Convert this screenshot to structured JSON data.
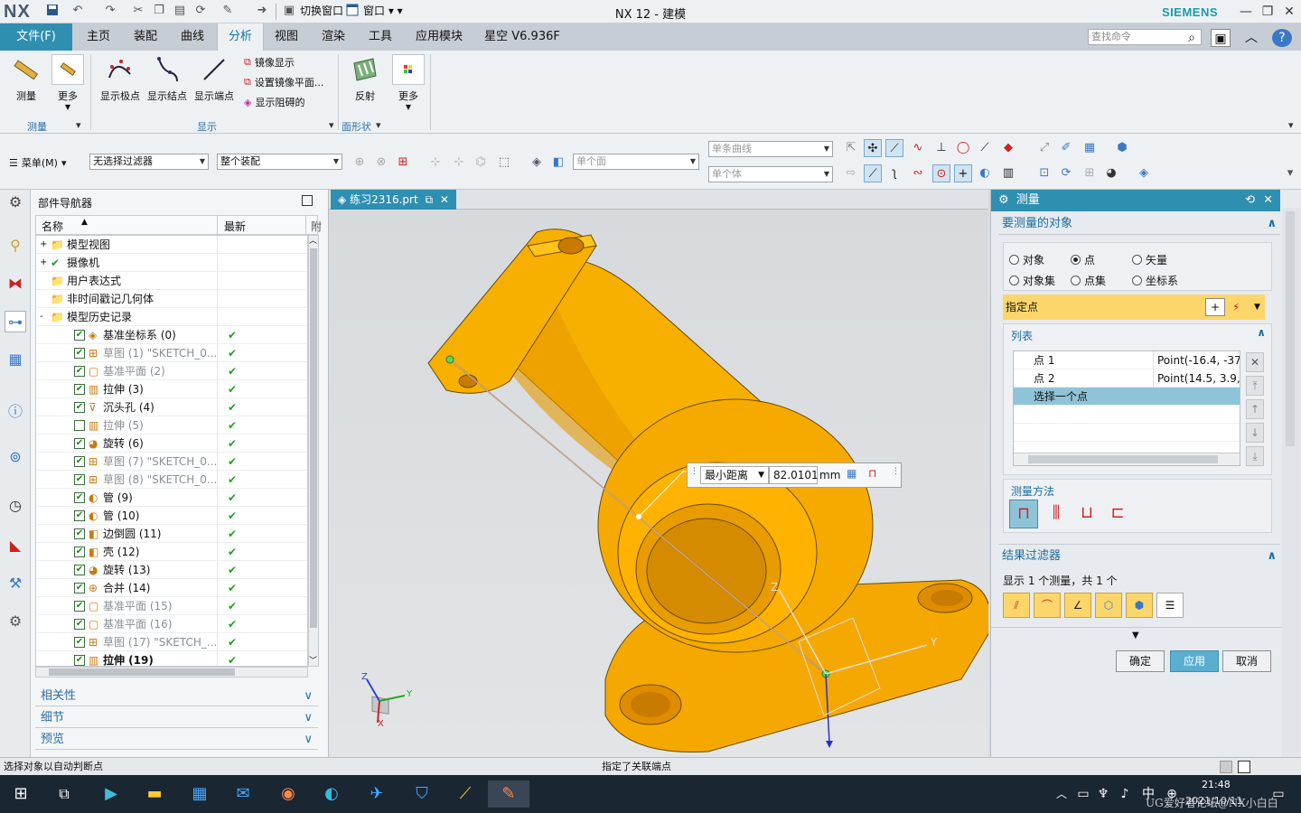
{
  "titlebar": {
    "logo": "NX",
    "switch_window": "切换窗口",
    "window_menu": "窗口",
    "title": "NX 12 - 建模",
    "brand": "SIEMENS"
  },
  "ribbon_tabs": {
    "file": "文件(F)",
    "tabs": [
      "主页",
      "装配",
      "曲线",
      "分析",
      "视图",
      "渲染",
      "工具",
      "应用模块",
      "星空 V6.936F"
    ],
    "active_index": 3,
    "search_placeholder": "查找命令"
  },
  "ribbon": {
    "measure": "测量",
    "more1": "更多",
    "group_measure": "测量",
    "show_poles": "显示极点",
    "show_knots": "显示结点",
    "show_endpoints": "显示端点",
    "mirror_display": "镜像显示",
    "set_mirror_plane": "设置镜像平面...",
    "show_blocked": "显示阻碍的",
    "group_display": "显示",
    "reflection": "反射",
    "group_surface": "面形状",
    "more2": "更多"
  },
  "toolbar2": {
    "menu": "菜单(M)",
    "filter": "无选择过滤器",
    "assembly_scope": "整个装配",
    "single_face": "单个面",
    "single_curve": "单条曲线",
    "single_body": "单个体"
  },
  "navigator": {
    "title": "部件导航器",
    "col_name": "名称",
    "col_latest": "最新",
    "col_extra": "附",
    "rows": [
      {
        "label": "模型视图",
        "level": 0,
        "check": false,
        "latest": false,
        "dim": false,
        "cb": "none",
        "exp": "+"
      },
      {
        "label": "摄像机",
        "level": 0,
        "check": true,
        "latest": false,
        "dim": false,
        "cb": "none",
        "exp": "+"
      },
      {
        "label": "用户表达式",
        "level": 0,
        "check": false,
        "latest": false,
        "dim": false,
        "cb": "none",
        "exp": ""
      },
      {
        "label": "非时间戳记几何体",
        "level": 0,
        "check": false,
        "latest": false,
        "dim": false,
        "cb": "none",
        "exp": ""
      },
      {
        "label": "模型历史记录",
        "level": 0,
        "check": false,
        "latest": false,
        "dim": false,
        "cb": "none",
        "exp": "-"
      },
      {
        "label": "基准坐标系 (0)",
        "level": 1,
        "check": true,
        "latest": true,
        "dim": false,
        "cb": "on"
      },
      {
        "label": "草图 (1) \"SKETCH_0...",
        "level": 1,
        "check": true,
        "latest": true,
        "dim": true,
        "cb": "on"
      },
      {
        "label": "基准平面 (2)",
        "level": 1,
        "check": true,
        "latest": true,
        "dim": true,
        "cb": "on"
      },
      {
        "label": "拉伸 (3)",
        "level": 1,
        "check": true,
        "latest": true,
        "dim": false,
        "cb": "on"
      },
      {
        "label": "沉头孔 (4)",
        "level": 1,
        "check": true,
        "latest": true,
        "dim": false,
        "cb": "on"
      },
      {
        "label": "拉伸 (5)",
        "level": 1,
        "check": false,
        "latest": true,
        "dim": true,
        "cb": "off"
      },
      {
        "label": "旋转 (6)",
        "level": 1,
        "check": true,
        "latest": true,
        "dim": false,
        "cb": "on"
      },
      {
        "label": "草图 (7) \"SKETCH_0...",
        "level": 1,
        "check": true,
        "latest": true,
        "dim": true,
        "cb": "on"
      },
      {
        "label": "草图 (8) \"SKETCH_0...",
        "level": 1,
        "check": true,
        "latest": true,
        "dim": true,
        "cb": "on"
      },
      {
        "label": "管 (9)",
        "level": 1,
        "check": true,
        "latest": true,
        "dim": false,
        "cb": "on"
      },
      {
        "label": "管 (10)",
        "level": 1,
        "check": true,
        "latest": true,
        "dim": false,
        "cb": "on"
      },
      {
        "label": "边倒圆 (11)",
        "level": 1,
        "check": true,
        "latest": true,
        "dim": false,
        "cb": "on"
      },
      {
        "label": "壳 (12)",
        "level": 1,
        "check": true,
        "latest": true,
        "dim": false,
        "cb": "on"
      },
      {
        "label": "旋转 (13)",
        "level": 1,
        "check": true,
        "latest": true,
        "dim": false,
        "cb": "on"
      },
      {
        "label": "合并 (14)",
        "level": 1,
        "check": true,
        "latest": true,
        "dim": false,
        "cb": "on"
      },
      {
        "label": "基准平面 (15)",
        "level": 1,
        "check": true,
        "latest": true,
        "dim": true,
        "cb": "on"
      },
      {
        "label": "基准平面 (16)",
        "level": 1,
        "check": true,
        "latest": true,
        "dim": true,
        "cb": "on"
      },
      {
        "label": "草图 (17) \"SKETCH_...",
        "level": 1,
        "check": true,
        "latest": true,
        "dim": true,
        "cb": "on"
      },
      {
        "label": "拉伸 (19)",
        "level": 1,
        "check": true,
        "latest": true,
        "dim": false,
        "cb": "on",
        "bold": true
      }
    ],
    "panels": [
      "相关性",
      "细节",
      "预览"
    ]
  },
  "graphics": {
    "tab": "练习2316.prt",
    "tooltip_mode": "最小距离",
    "tooltip_value": "82.0101",
    "tooltip_unit": "mm",
    "axis_z": "Z",
    "axis_y": "Y",
    "axis_x": "X"
  },
  "measure_panel": {
    "title": "测量",
    "section_objects": "要测量的对象",
    "radios": [
      "对象",
      "点",
      "矢量",
      "对象集",
      "点集",
      "坐标系"
    ],
    "radio_selected": 1,
    "specify_point": "指定点",
    "list_title": "列表",
    "list_rows": [
      {
        "name": "点 1",
        "value": "Point(-16.4, -37.6"
      },
      {
        "name": "点 2",
        "value": "Point(14.5, 3.9, 1"
      },
      {
        "name": "选择一个点",
        "value": ""
      }
    ],
    "method_title": "测量方法",
    "filter_title": "结果过滤器",
    "filter_text": "显示 1 个测量，共 1 个",
    "ok": "确定",
    "apply": "应用",
    "cancel": "取消"
  },
  "status": {
    "left": "选择对象以自动判断点",
    "center": "指定了关联端点"
  },
  "taskbar": {
    "time": "21:48",
    "ime": "中",
    "date": "2021/10/11",
    "watermark": "UG爱好者论坛@NX小白白"
  }
}
